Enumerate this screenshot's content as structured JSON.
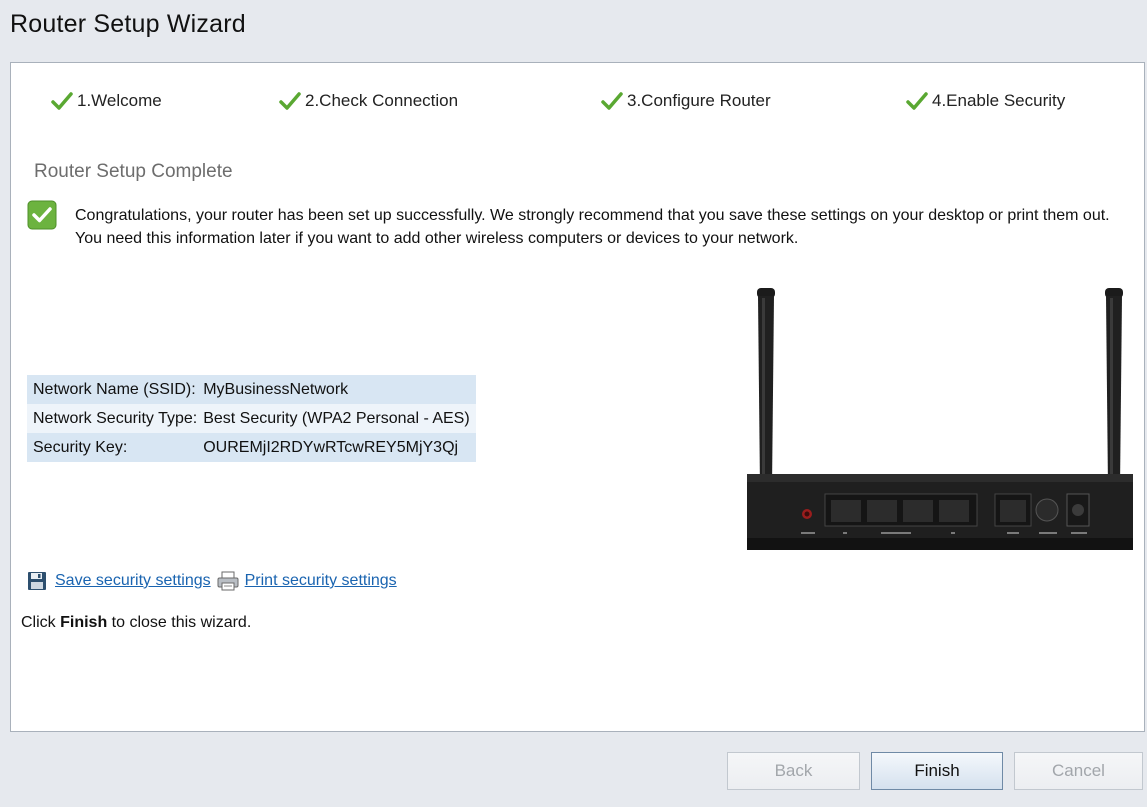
{
  "window": {
    "title": "Router Setup Wizard"
  },
  "steps": [
    {
      "label": "1.Welcome",
      "icon": "checkmark-icon"
    },
    {
      "label": "2.Check Connection",
      "icon": "checkmark-icon"
    },
    {
      "label": "3.Configure Router",
      "icon": "checkmark-icon"
    },
    {
      "label": "4.Enable Security",
      "icon": "checkmark-icon"
    }
  ],
  "main": {
    "subtitle": "Router Setup Complete",
    "message": "Congratulations, your router has been set up successfully. We strongly recommend that you save these settings on your desktop or print them out. You need this information later if you want to add other wireless computers or devices to your network.",
    "settings": [
      {
        "label": "Network Name (SSID):",
        "value": "MyBusinessNetwork"
      },
      {
        "label": "Network Security Type:",
        "value": "Best Security (WPA2 Personal - AES)"
      },
      {
        "label": "Security Key:",
        "value": "OUREMjI2RDYwRTcwREY5MjY3Qj"
      }
    ],
    "save_link": "Save security settings",
    "print_link": "Print security settings",
    "finish_prefix": "Click ",
    "finish_bold": "Finish",
    "finish_suffix": " to close this wizard."
  },
  "buttons": {
    "back": "Back",
    "finish": "Finish",
    "cancel": "Cancel"
  },
  "colors": {
    "accent_green": "#6cb33f",
    "link": "#1a64b0",
    "table_row": "#d8e6f3"
  }
}
